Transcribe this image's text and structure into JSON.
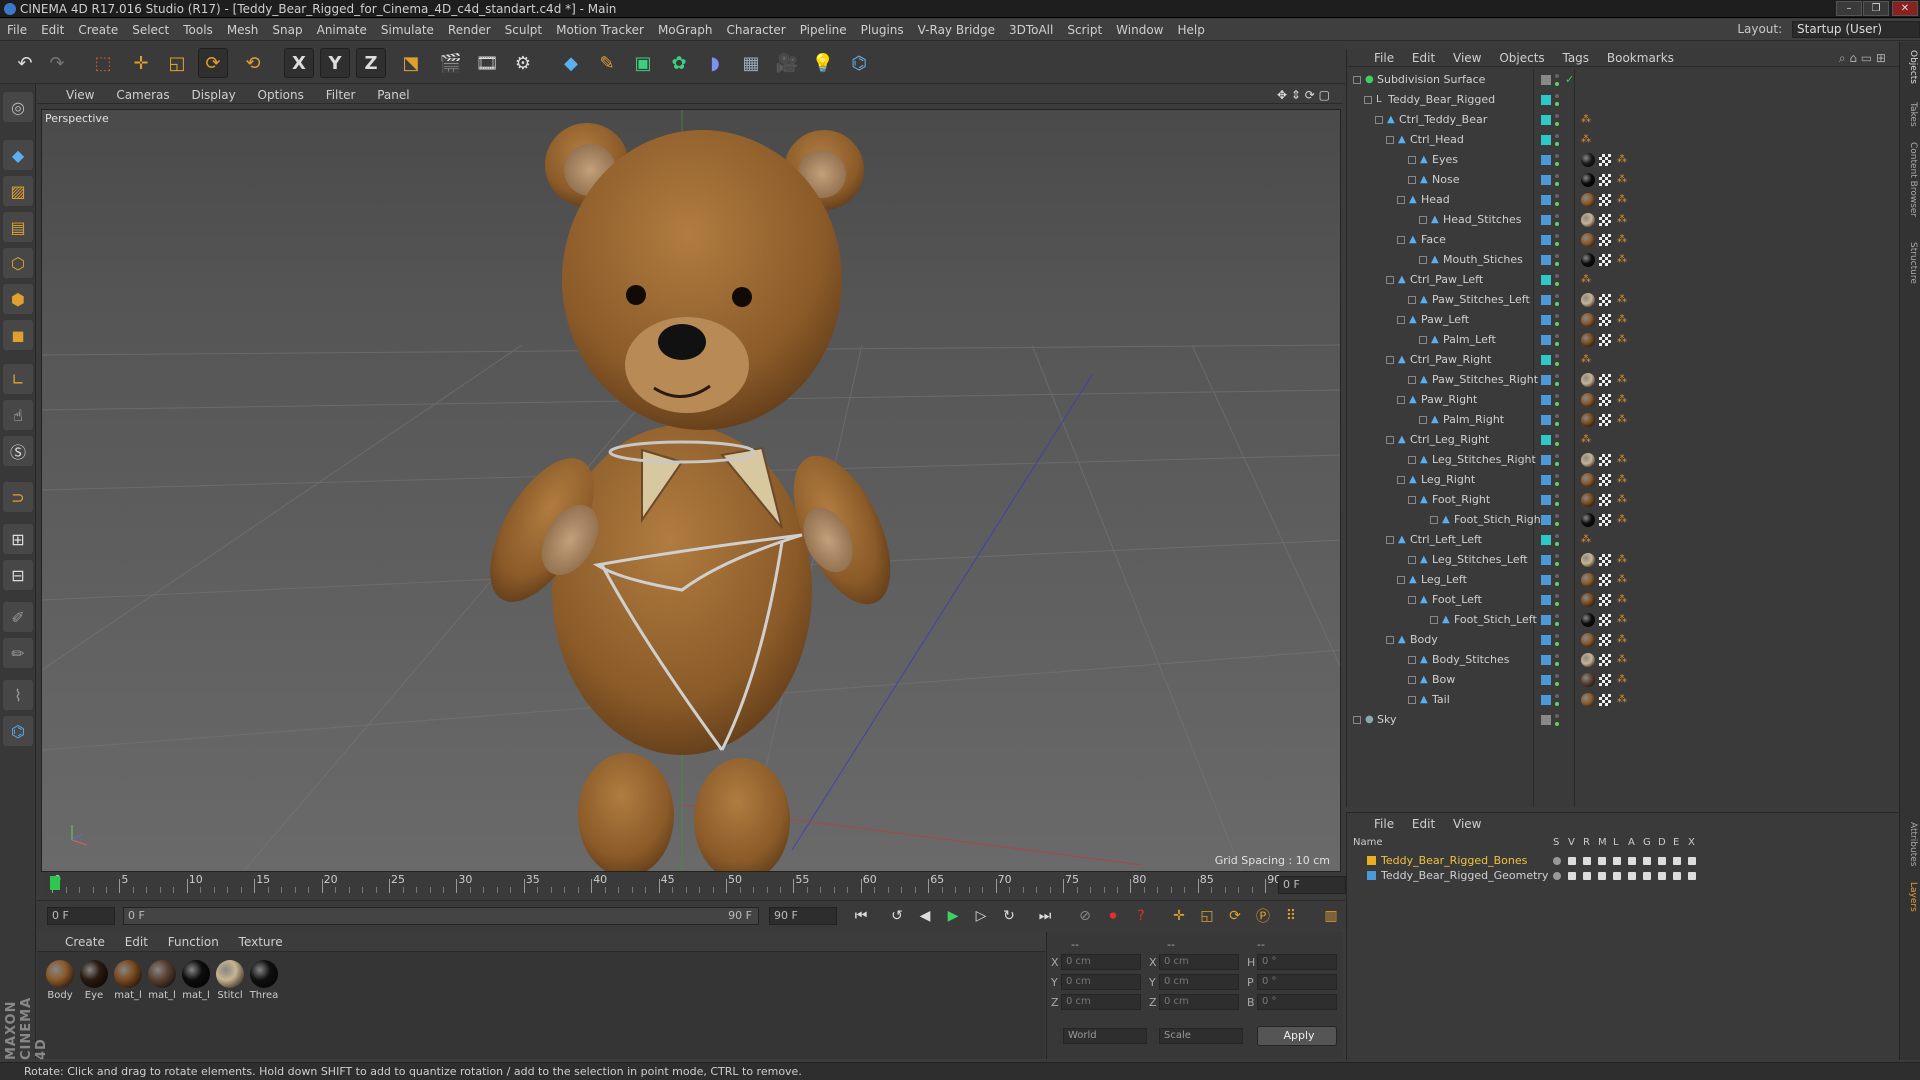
{
  "window": {
    "title": "CINEMA 4D R17.016 Studio (R17) - [Teddy_Bear_Rigged_for_Cinema_4D_c4d_standart.c4d *] - Main",
    "controls": [
      "–",
      "❐",
      "✕"
    ]
  },
  "menubar": {
    "items": [
      "File",
      "Edit",
      "Create",
      "Select",
      "Tools",
      "Mesh",
      "Snap",
      "Animate",
      "Simulate",
      "Render",
      "Sculpt",
      "Motion Tracker",
      "MoGraph",
      "Character",
      "Pipeline",
      "Plugins",
      "V-Ray Bridge",
      "3DToAll",
      "Script",
      "Window",
      "Help"
    ],
    "layout_label": "Layout:",
    "layout_value": "Startup (User)"
  },
  "toolbar": {
    "axis_x": "X",
    "axis_y": "Y",
    "axis_z": "Z"
  },
  "viewport": {
    "menu": [
      "View",
      "Cameras",
      "Display",
      "Options",
      "Filter",
      "Panel"
    ],
    "label": "Perspective",
    "grid_spacing": "Grid Spacing : 10 cm"
  },
  "timeline": {
    "ticks": [
      "0",
      "5",
      "10",
      "15",
      "20",
      "25",
      "30",
      "35",
      "40",
      "45",
      "50",
      "55",
      "60",
      "65",
      "70",
      "75",
      "80",
      "85",
      "90"
    ],
    "current_frame": "0 F",
    "start_field": "0 F",
    "range_start": "0 F",
    "range_end": "90 F",
    "end_field": "90 F"
  },
  "materials": {
    "menu": [
      "Create",
      "Edit",
      "Function",
      "Texture"
    ],
    "items": [
      {
        "label": "Body",
        "color": "#8a5a2a"
      },
      {
        "label": "Eye",
        "color": "#2a1a10"
      },
      {
        "label": "mat_l",
        "color": "#7a4a1e"
      },
      {
        "label": "mat_l",
        "color": "#5a4030"
      },
      {
        "label": "mat_l",
        "color": "#0c0c0c"
      },
      {
        "label": "Stitcl",
        "color": "#c8b490"
      },
      {
        "label": "Threa",
        "color": "#101010"
      }
    ]
  },
  "coordinates": {
    "header": [
      "--",
      "--",
      "--"
    ],
    "rows": [
      {
        "a": "X",
        "av": "0 cm",
        "b": "X",
        "bv": "0 cm",
        "c": "H",
        "cv": "0 °"
      },
      {
        "a": "Y",
        "av": "0 cm",
        "b": "Y",
        "bv": "0 cm",
        "c": "P",
        "cv": "0 °"
      },
      {
        "a": "Z",
        "av": "0 cm",
        "b": "Z",
        "bv": "0 cm",
        "c": "B",
        "cv": "0 °"
      }
    ],
    "world": "World",
    "scale": "Scale",
    "apply": "Apply"
  },
  "status": "Rotate: Click and drag to rotate elements. Hold down SHIFT to add to quantize rotation / add to the selection in point mode, CTRL to remove.",
  "objects": {
    "menu": [
      "File",
      "Edit",
      "View",
      "Objects",
      "Tags",
      "Bookmarks"
    ],
    "rows": [
      {
        "name": "Subdivision Surface",
        "level": 0,
        "type": "subdiv",
        "swatch": "#888"
      },
      {
        "name": "Teddy_Bear_Rigged",
        "level": 1,
        "type": "null",
        "swatch": "#2ec8c8"
      },
      {
        "name": "Ctrl_Teddy_Bear",
        "level": 2,
        "type": "joint",
        "swatch": "#2ec8c8"
      },
      {
        "name": "Ctrl_Head",
        "level": 3,
        "type": "joint",
        "swatch": "#2ec8c8"
      },
      {
        "name": "Eyes",
        "level": 5,
        "type": "joint",
        "swatch": "#4a9ad8",
        "mat": "#1a1a1a"
      },
      {
        "name": "Nose",
        "level": 5,
        "type": "joint",
        "swatch": "#4a9ad8",
        "mat": "#0a0a0a"
      },
      {
        "name": "Head",
        "level": 4,
        "type": "joint",
        "swatch": "#4a9ad8",
        "mat": "#8a5a2a"
      },
      {
        "name": "Head_Stitches",
        "level": 6,
        "type": "joint",
        "swatch": "#4a9ad8",
        "mat": "#c8b490"
      },
      {
        "name": "Face",
        "level": 4,
        "type": "joint",
        "swatch": "#4a9ad8",
        "mat": "#8a5a2a"
      },
      {
        "name": "Mouth_Stiches",
        "level": 6,
        "type": "joint",
        "swatch": "#4a9ad8",
        "mat": "#0c0c0c"
      },
      {
        "name": "Ctrl_Paw_Left",
        "level": 3,
        "type": "joint",
        "swatch": "#2ec8c8"
      },
      {
        "name": "Paw_Stitches_Left",
        "level": 5,
        "type": "joint",
        "swatch": "#4a9ad8",
        "mat": "#c8b490"
      },
      {
        "name": "Paw_Left",
        "level": 4,
        "type": "joint",
        "swatch": "#4a9ad8",
        "mat": "#8a5a2a"
      },
      {
        "name": "Palm_Left",
        "level": 6,
        "type": "joint",
        "swatch": "#4a9ad8",
        "mat": "#7a4a1e"
      },
      {
        "name": "Ctrl_Paw_Right",
        "level": 3,
        "type": "joint",
        "swatch": "#2ec8c8"
      },
      {
        "name": "Paw_Stitches_Right",
        "level": 5,
        "type": "joint",
        "swatch": "#4a9ad8",
        "mat": "#c8b490"
      },
      {
        "name": "Paw_Right",
        "level": 4,
        "type": "joint",
        "swatch": "#4a9ad8",
        "mat": "#8a5a2a"
      },
      {
        "name": "Palm_Right",
        "level": 6,
        "type": "joint",
        "swatch": "#4a9ad8",
        "mat": "#7a4a1e"
      },
      {
        "name": "Ctrl_Leg_Right",
        "level": 3,
        "type": "joint",
        "swatch": "#2ec8c8"
      },
      {
        "name": "Leg_Stitches_Right",
        "level": 5,
        "type": "joint",
        "swatch": "#4a9ad8",
        "mat": "#c8b490"
      },
      {
        "name": "Leg_Right",
        "level": 4,
        "type": "joint",
        "swatch": "#4a9ad8",
        "mat": "#8a5a2a"
      },
      {
        "name": "Foot_Right",
        "level": 5,
        "type": "joint",
        "swatch": "#4a9ad8",
        "mat": "#7a4a1e"
      },
      {
        "name": "Foot_Stich_Righ",
        "level": 7,
        "type": "joint",
        "swatch": "#4a9ad8",
        "mat": "#0c0c0c"
      },
      {
        "name": "Ctrl_Left_Left",
        "level": 3,
        "type": "joint",
        "swatch": "#2ec8c8"
      },
      {
        "name": "Leg_Stitches_Left",
        "level": 5,
        "type": "joint",
        "swatch": "#4a9ad8",
        "mat": "#c8b490"
      },
      {
        "name": "Leg_Left",
        "level": 4,
        "type": "joint",
        "swatch": "#4a9ad8",
        "mat": "#8a5a2a"
      },
      {
        "name": "Foot_Left",
        "level": 5,
        "type": "joint",
        "swatch": "#4a9ad8",
        "mat": "#7a4a1e"
      },
      {
        "name": "Foot_Stich_Left",
        "level": 7,
        "type": "joint",
        "swatch": "#4a9ad8",
        "mat": "#0c0c0c"
      },
      {
        "name": "Body",
        "level": 3,
        "type": "joint",
        "swatch": "#4a9ad8",
        "mat": "#8a5a2a"
      },
      {
        "name": "Body_Stitches",
        "level": 5,
        "type": "joint",
        "swatch": "#4a9ad8",
        "mat": "#c8b490"
      },
      {
        "name": "Bow",
        "level": 5,
        "type": "joint",
        "swatch": "#4a9ad8",
        "mat": "#5a4030"
      },
      {
        "name": "Tail",
        "level": 5,
        "type": "joint",
        "swatch": "#4a9ad8",
        "mat": "#8a5a2a"
      },
      {
        "name": "Sky",
        "level": 0,
        "type": "sky",
        "swatch": "#888"
      }
    ]
  },
  "layers": {
    "menu": [
      "File",
      "Edit",
      "View"
    ],
    "header_name": "Name",
    "header_flags": [
      "S",
      "V",
      "R",
      "M",
      "L",
      "A",
      "G",
      "D",
      "E",
      "X"
    ],
    "rows": [
      {
        "name": "Teddy_Bear_Rigged_Bones",
        "color": "#e8b020",
        "text_color": "#f0c040"
      },
      {
        "name": "Teddy_Bear_Rigged_Geometry",
        "color": "#4a9ad8",
        "text_color": "#d0d0d0"
      }
    ]
  },
  "right_tabs": [
    "Objects",
    "Takes",
    "Content Browser",
    "Structure",
    "Attributes",
    "Layers"
  ],
  "branding": "MAXON CINEMA 4D"
}
